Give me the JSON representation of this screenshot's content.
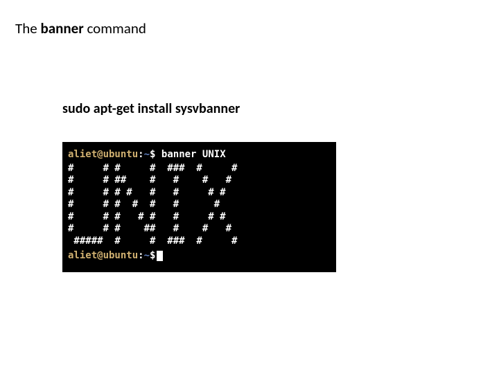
{
  "title": {
    "part1": "The ",
    "part2": "banner ",
    "part3": "command"
  },
  "install_command": "sudo apt-get install sysvbanner",
  "terminal": {
    "user": "aliet@ubuntu",
    "sep": ":",
    "path": "~",
    "dollar": "$",
    "command": "banner UNIX",
    "output": "#     # #     #  ###  #     #\n#     # ##    #   #    #   #\n#     # # #   #   #     # #\n#     # #  #  #   #      #\n#     # #   # #   #     # #\n#     # #    ##   #    #   #\n #####  #     #  ###  #     #",
    "user2": "aliet@ubuntu",
    "path2": "~"
  }
}
